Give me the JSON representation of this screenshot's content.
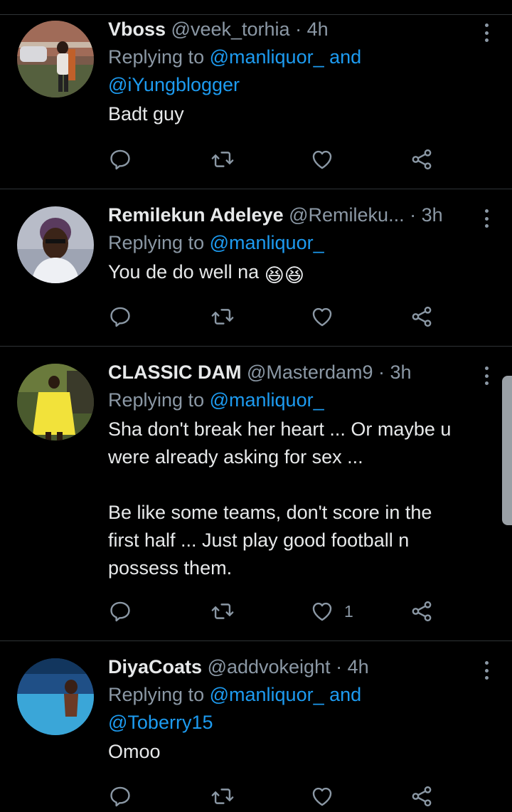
{
  "tweets": [
    {
      "name": "Vboss",
      "handle": "@veek_torhia",
      "dot": "·",
      "time": "4h",
      "reply_prefix": "Replying to",
      "reply_mention1": "@manliquor_",
      "reply_and": "and",
      "reply_mention2": "@iYungblogger",
      "body": "Badt guy",
      "like_count": ""
    },
    {
      "name": "Remilekun Adeleye",
      "handle": "@Remileku...",
      "dot": "·",
      "time": "3h",
      "reply_prefix": "Replying to",
      "reply_mention1": "@manliquor_",
      "body": "You de do well na",
      "emoji": [
        "😆",
        "😆"
      ],
      "like_count": ""
    },
    {
      "name": "CLASSIC DAM",
      "handle": "@Masterdam9",
      "dot": "·",
      "time": "3h",
      "reply_prefix": "Replying to",
      "reply_mention1": "@manliquor_",
      "body": "Sha don't break her heart ... Or maybe u\nwere already asking for sex ...\n\nBe like some teams, don't score in the\nfirst half ... Just play good football n\npossess them.",
      "like_count": "1"
    },
    {
      "name": "DiyaCoats",
      "handle": "@addvokeight",
      "dot": "·",
      "time": "4h",
      "reply_prefix": "Replying to",
      "reply_mention1": "@manliquor_",
      "reply_and": "and",
      "reply_mention2": "@Toberry15",
      "body": "Omoo",
      "like_count": ""
    }
  ],
  "icons": {
    "reply": "reply-icon",
    "retweet": "retweet-icon",
    "like": "heart-icon",
    "share": "share-icon",
    "more": "more-icon"
  },
  "colors": {
    "background": "#000000",
    "text": "#e7e9ea",
    "muted": "#8b98a5",
    "link": "#1d9bf0",
    "divider": "#2f3336"
  }
}
